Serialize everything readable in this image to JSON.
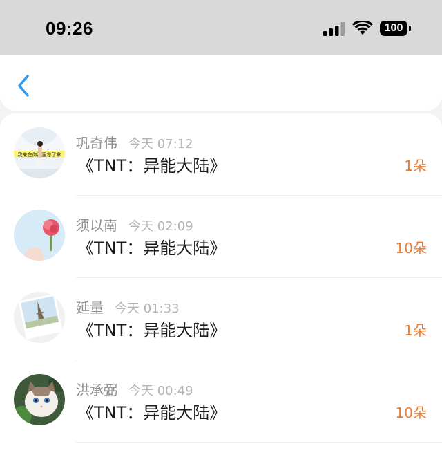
{
  "status_bar": {
    "time": "09:26",
    "battery": "100",
    "icons": [
      "cellular-signal-icon",
      "wifi-icon",
      "battery-icon"
    ]
  },
  "nav": {
    "back_icon": "chevron-left-icon",
    "accent_color": "#2e9bf0"
  },
  "list": {
    "items": [
      {
        "name": "巩奇伟",
        "time": "今天 07:12",
        "title": "《TNT：异能大陆》",
        "count": "1朵",
        "avatar_banner_text": "我来在你那里忘了拿"
      },
      {
        "name": "须以南",
        "time": "今天 02:09",
        "title": "《TNT：异能大陆》",
        "count": "10朵"
      },
      {
        "name": "延量",
        "time": "今天 01:33",
        "title": "《TNT：异能大陆》",
        "count": "1朵"
      },
      {
        "name": "洪承弼",
        "time": "今天 00:49",
        "title": "《TNT：异能大陆》",
        "count": "10朵"
      }
    ]
  },
  "colors": {
    "count": "#ef7a2c",
    "name": "#8f8f8f",
    "time": "#b3b3b3",
    "title": "#1c1c1c",
    "status_bar_bg": "#d9d9d9"
  }
}
